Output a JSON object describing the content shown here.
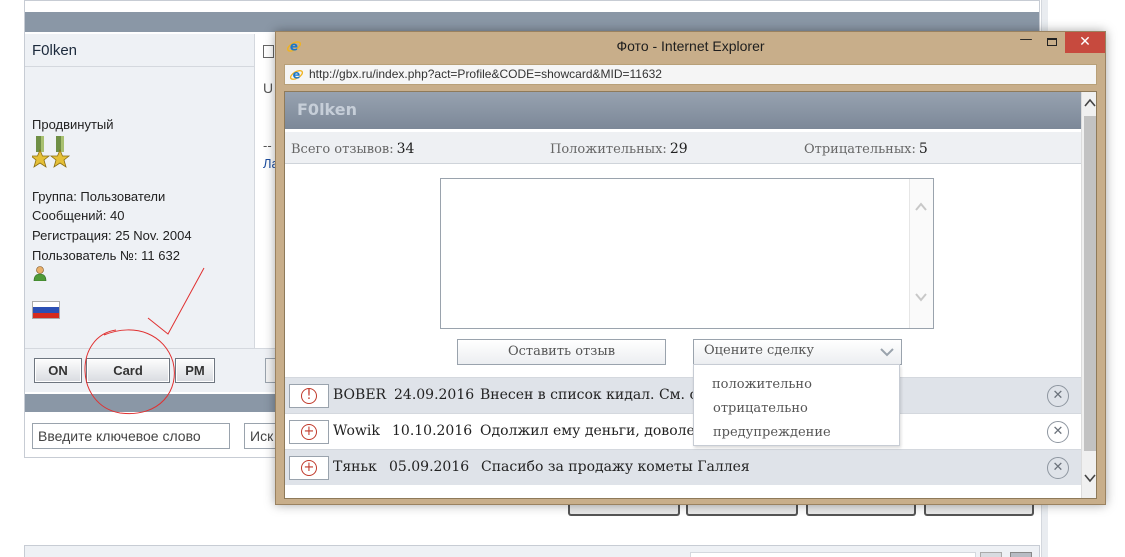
{
  "forum": {
    "username": "F0lken",
    "rank": "Продвинутый",
    "info": [
      "Группа: Пользователи",
      "Сообщений: 40",
      "Регистрация: 25 Nov. 2004",
      "Пользователь №: 11 632"
    ],
    "buttons": {
      "on": "ON",
      "card": "Card",
      "pm": "PM"
    },
    "search_placeholder": "Введите ключевое слово",
    "search_button": "Иск",
    "content_fragment_u": "U",
    "content_fragment_dash": "--",
    "content_fragment_link": "Ла"
  },
  "ie": {
    "title": "Фото - Internet Explorer",
    "url": "http://gbx.ru/index.php?act=Profile&CODE=showcard&MID=11632",
    "controls": {
      "minimize": "—",
      "close": "✕"
    }
  },
  "card": {
    "title": "F0lken",
    "stats": {
      "total_label": "Всего отзывов:",
      "total_value": "34",
      "positive_label": "Положительных:",
      "positive_value": "29",
      "negative_label": "Отрицательных:",
      "negative_value": "5"
    },
    "submit_label": "Оставить отзыв",
    "rate_placeholder": "Оцените сделку",
    "rate_options": [
      "положительно",
      "отрицательно",
      "предупреждение"
    ],
    "reviews": [
      {
        "user": "BOBER",
        "date": "24.09.2016",
        "text": "Внесен в список кидал. См. сс",
        "icon": "warning-icon"
      },
      {
        "user": "Wowik",
        "date": "10.10.2016",
        "text": "Одолжил ему деньги, доволен",
        "icon": "plus-icon"
      },
      {
        "user": "Тяньк",
        "date": "05.09.2016",
        "text": "Спасибо за продажу кометы Галлея",
        "icon": "plus-icon"
      }
    ],
    "remove_icon": "✕"
  },
  "colors": {
    "ie_frame": "#c8ae8a",
    "close_button": "#c74a3e",
    "card_header": "#8a96a5",
    "annotation": "#e03030"
  }
}
